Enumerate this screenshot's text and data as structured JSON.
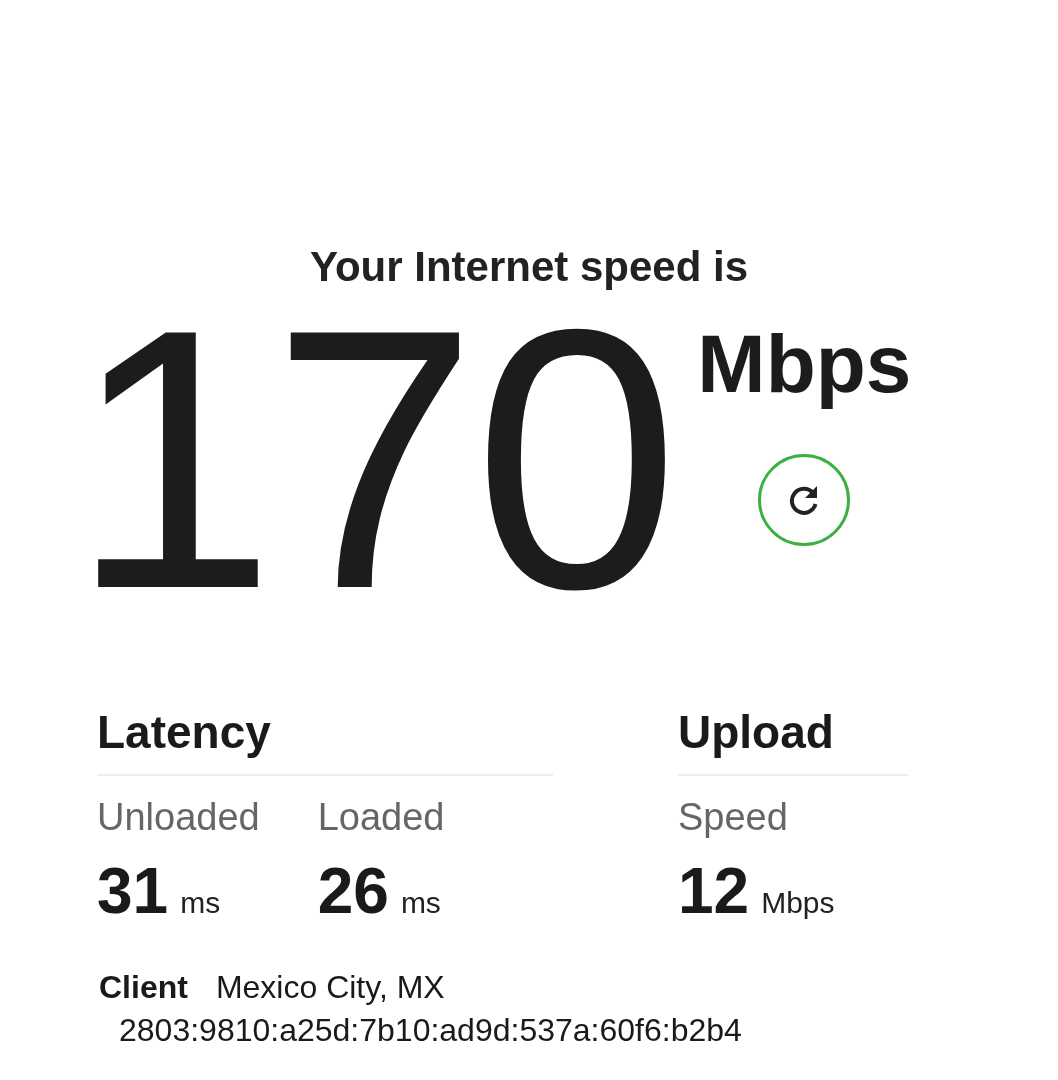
{
  "heading": "Your Internet speed is",
  "speed": {
    "value": "170",
    "unit": "Mbps"
  },
  "sections": [
    {
      "title": "Latency",
      "metrics": [
        {
          "label": "Unloaded",
          "value": "31",
          "unit": "ms"
        },
        {
          "label": "Loaded",
          "value": "26",
          "unit": "ms"
        }
      ]
    },
    {
      "title": "Upload",
      "metrics": [
        {
          "label": "Speed",
          "value": "12",
          "unit": "Mbps"
        }
      ]
    }
  ],
  "client": {
    "label": "Client",
    "location": "Mexico City, MX",
    "address": "2803:9810:a25d:7b10:ad9d:537a:60f6:b2b4"
  }
}
